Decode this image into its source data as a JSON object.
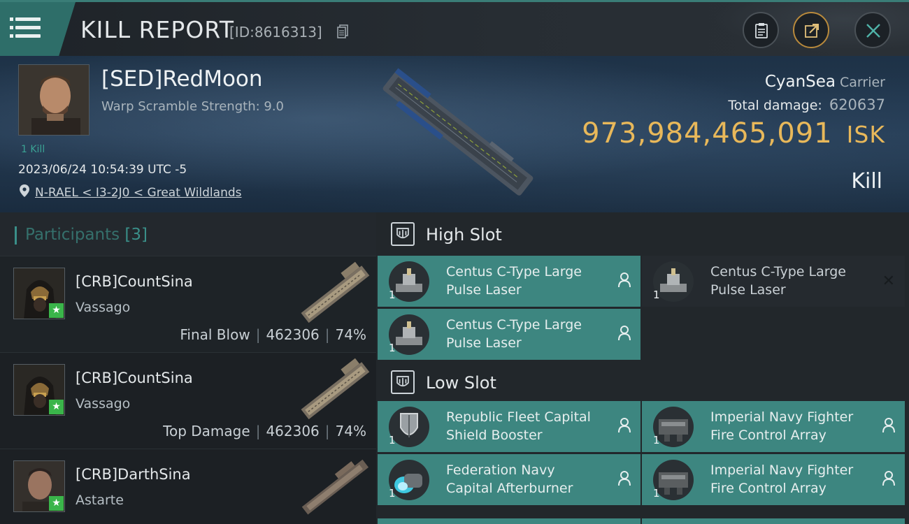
{
  "header": {
    "title": "KILL REPORT",
    "report_id": "[ID:8616313]"
  },
  "victim": {
    "name": "[SED]RedMoon",
    "warp_scramble": "Warp Scramble Strength: 9.0",
    "kill_tag": "1 Kill",
    "date": "2023/06/24 10:54:39 UTC -5",
    "location": "N-RAEL < I3-2J0 < Great Wildlands",
    "ship_name": "CyanSea",
    "ship_class": "Carrier",
    "total_damage_label": "Total damage:",
    "total_damage_value": "620637",
    "isk_value": "973,984,465,091",
    "isk_unit": "ISK",
    "result": "Kill"
  },
  "participants": {
    "title": "Participants",
    "count": "[3]",
    "rows": [
      {
        "name": "[CRB]CountSina",
        "ship": "Vassago",
        "role": "Final Blow",
        "damage": "462306",
        "percent": "74%"
      },
      {
        "name": "[CRB]CountSina",
        "ship": "Vassago",
        "role": "Top Damage",
        "damage": "462306",
        "percent": "74%"
      },
      {
        "name": "[CRB]DarthSina",
        "ship": "Astarte"
      }
    ]
  },
  "slots": {
    "high": {
      "title": "High Slot",
      "modules": [
        {
          "line1": "Centus C-Type Large",
          "line2": "Pulse Laser",
          "qty": "1"
        },
        {
          "line1": "Centus C-Type Large",
          "line2": "Pulse Laser",
          "qty": "1"
        },
        {
          "line1": "Centus C-Type Large",
          "line2": "Pulse Laser",
          "qty": "1"
        }
      ]
    },
    "low": {
      "title": "Low Slot",
      "modules": [
        {
          "line1": "Republic Fleet Capital",
          "line2": "Shield Booster",
          "qty": "1"
        },
        {
          "line1": "Imperial Navy Fighter",
          "line2": "Fire Control Array",
          "qty": "1"
        },
        {
          "line1": "Federation Navy",
          "line2": "Capital Afterburner",
          "qty": "1"
        },
        {
          "line1": "Imperial Navy Fighter",
          "line2": "Fire Control Array",
          "qty": "1"
        }
      ]
    }
  },
  "colors": {
    "accent_teal": "#3d8680",
    "isk_gold": "#e8b85a",
    "star_green": "#3ab54a"
  }
}
